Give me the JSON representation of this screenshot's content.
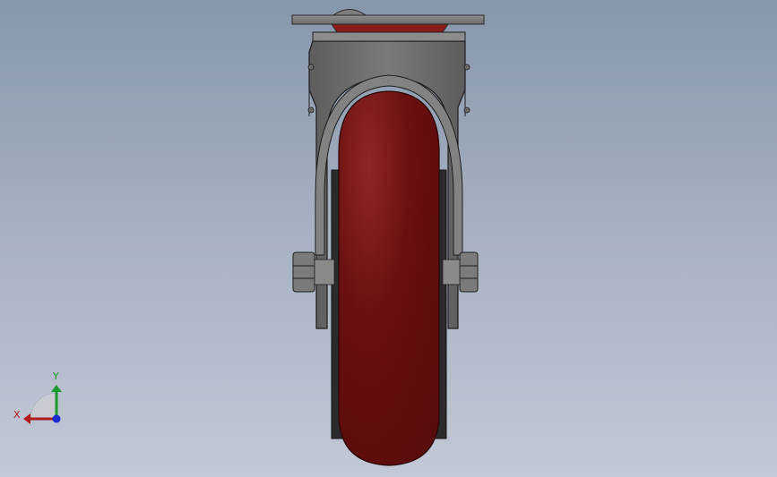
{
  "colors": {
    "background_top": "#8797ab",
    "background_bottom": "#c2c8d6",
    "wheel": "#7a1212",
    "bracket": "#6f6f6f",
    "axis_x": "#b01a1a",
    "axis_y": "#1a9a2a",
    "axis_z": "#1a2ad0"
  },
  "triad": {
    "x_label": "X",
    "y_label": "Y"
  }
}
